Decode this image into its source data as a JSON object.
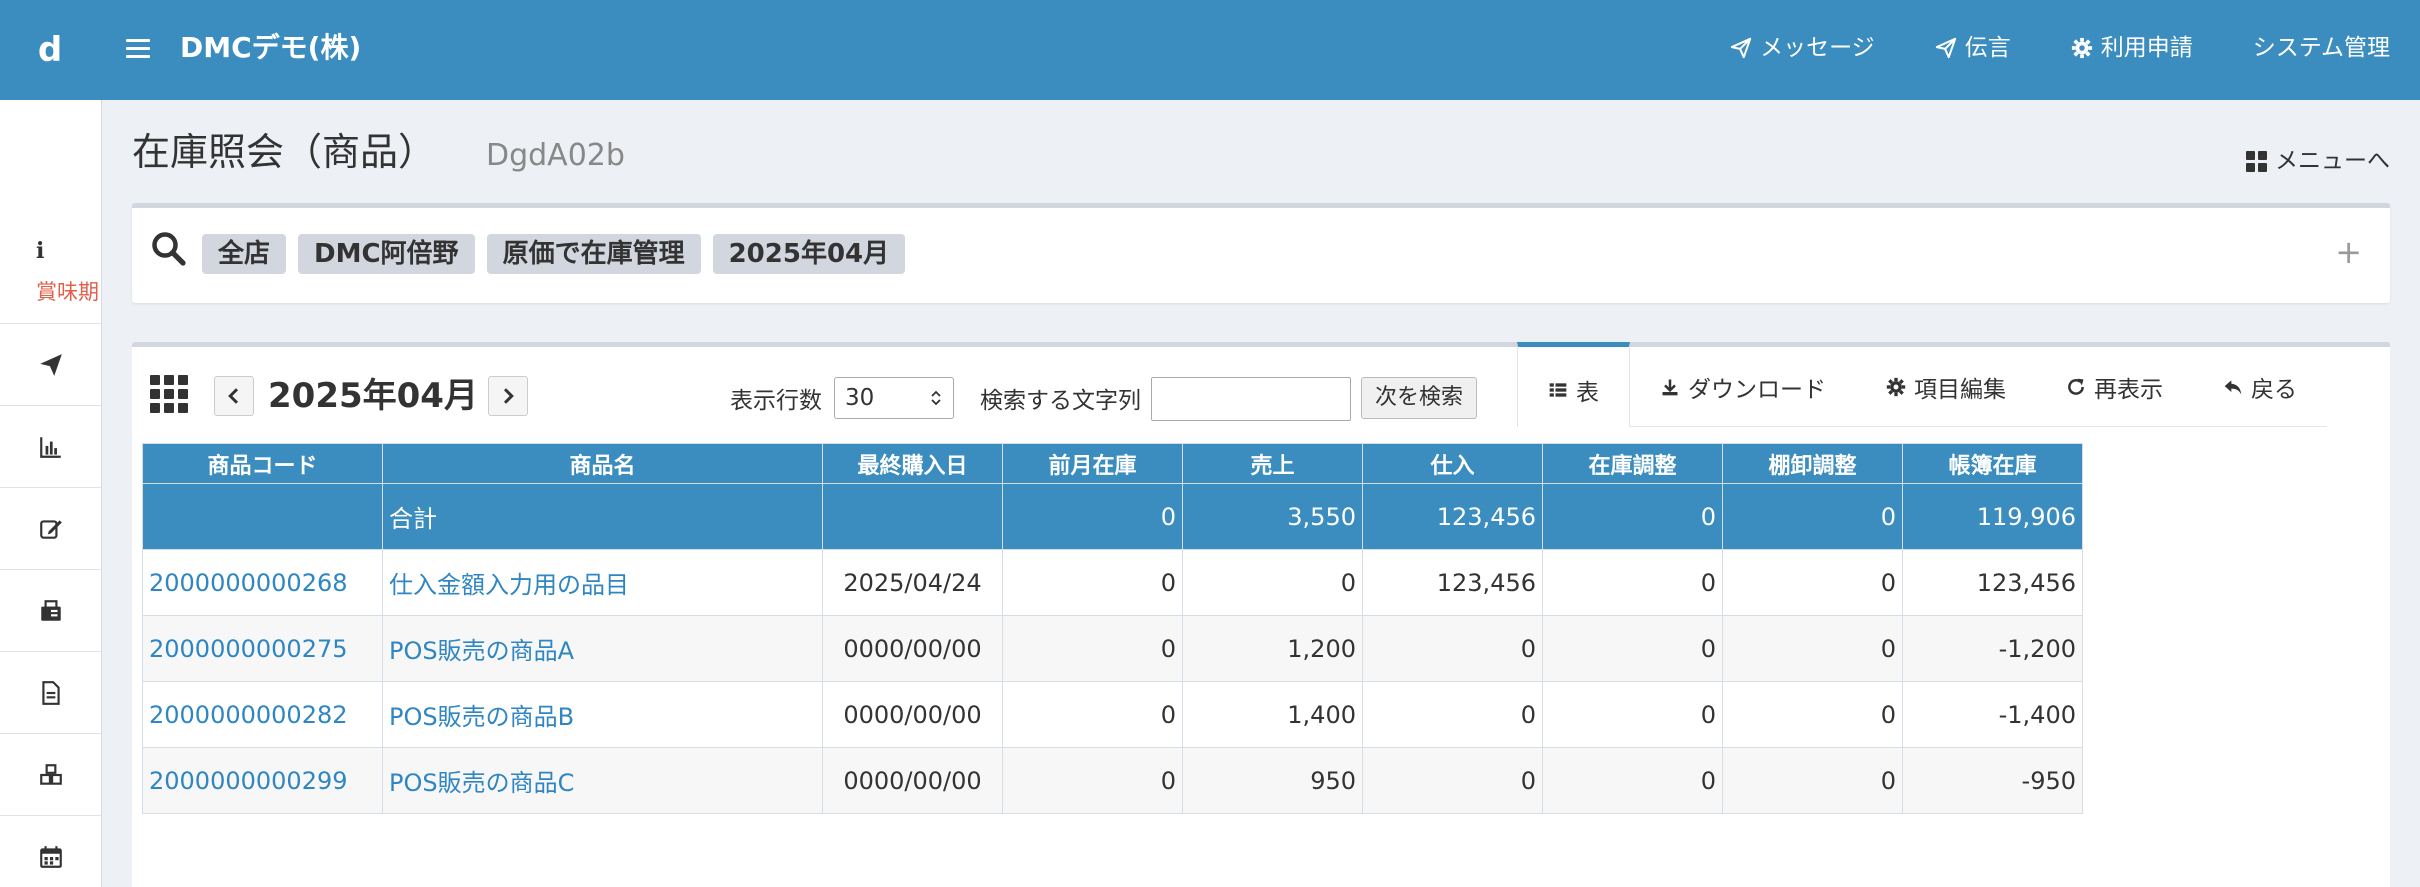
{
  "app": {
    "logo": "d",
    "company": "DMCデモ(株)",
    "nav": [
      {
        "label": "メッセージ",
        "icon": "paper-plane-icon"
      },
      {
        "label": "伝言",
        "icon": "paper-plane-icon"
      },
      {
        "label": "利用申請",
        "icon": "gear-icon"
      },
      {
        "label": "システム管理",
        "icon": ""
      }
    ]
  },
  "sidebar": {
    "info_icon": "i",
    "expiry_label": "賞味期",
    "icons": [
      "paper-plane-icon",
      "bar-chart-icon",
      "edit-icon",
      "fax-icon",
      "document-icon",
      "cubes-icon",
      "calendar-icon"
    ]
  },
  "header": {
    "title": "在庫照会（商品）",
    "code": "DgdA02b",
    "menu_link": "メニューへ"
  },
  "search": {
    "chips": [
      "全店",
      "DMC阿倍野",
      "原価で在庫管理",
      "2025年04月"
    ],
    "expand": "+"
  },
  "toolbar": {
    "month": "2025年04月",
    "rows_label": "表示行数",
    "rows_value": "30",
    "find_label": "検索する文字列",
    "find_value": "",
    "find_button": "次を検索",
    "tabs": [
      {
        "label": "表",
        "icon": "table-icon",
        "active": true
      },
      {
        "label": "ダウンロード",
        "icon": "download-icon",
        "active": false
      },
      {
        "label": "項目編集",
        "icon": "gear-icon",
        "active": false
      },
      {
        "label": "再表示",
        "icon": "refresh-icon",
        "active": false
      },
      {
        "label": "戻る",
        "icon": "reply-icon",
        "active": false
      }
    ]
  },
  "table": {
    "columns": [
      "商品コード",
      "商品名",
      "最終購入日",
      "前月在庫",
      "売上",
      "仕入",
      "在庫調整",
      "棚卸調整",
      "帳簿在庫"
    ],
    "total": {
      "code": "",
      "name": "合計",
      "date": "",
      "prev": "0",
      "sales": "3,550",
      "purchase": "123,456",
      "adjust": "0",
      "inventory": "0",
      "book": "119,906"
    },
    "rows": [
      {
        "code": "2000000000268",
        "name": "仕入金額入力用の品目",
        "date": "2025/04/24",
        "prev": "0",
        "sales": "0",
        "purchase": "123,456",
        "adjust": "0",
        "inventory": "0",
        "book": "123,456"
      },
      {
        "code": "2000000000275",
        "name": "POS販売の商品A",
        "date": "0000/00/00",
        "prev": "0",
        "sales": "1,200",
        "purchase": "0",
        "adjust": "0",
        "inventory": "0",
        "book": "-1,200"
      },
      {
        "code": "2000000000282",
        "name": "POS販売の商品B",
        "date": "0000/00/00",
        "prev": "0",
        "sales": "1,400",
        "purchase": "0",
        "adjust": "0",
        "inventory": "0",
        "book": "-1,400"
      },
      {
        "code": "2000000000299",
        "name": "POS販売の商品C",
        "date": "0000/00/00",
        "prev": "0",
        "sales": "950",
        "purchase": "0",
        "adjust": "0",
        "inventory": "0",
        "book": "-950"
      }
    ]
  }
}
